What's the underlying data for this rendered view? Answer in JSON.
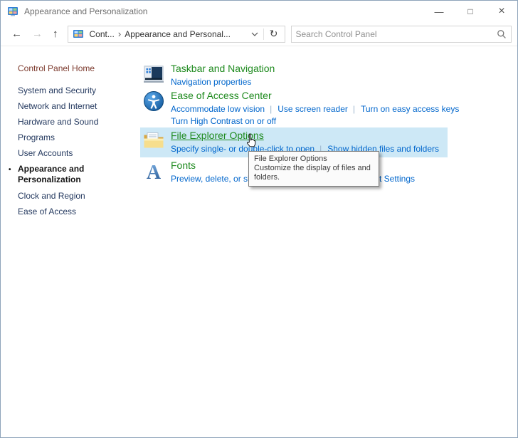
{
  "window": {
    "title": "Appearance and Personalization",
    "minimize_glyph": "—",
    "maximize_glyph": "□",
    "close_glyph": "×"
  },
  "navbar": {
    "back_glyph": "←",
    "forward_glyph": "→",
    "up_glyph": "↑",
    "refresh_glyph": "↻",
    "separator_glyph": "›",
    "breadcrumb": [
      {
        "label": "Cont..."
      },
      {
        "label": "Appearance and Personal..."
      }
    ],
    "search_placeholder": "Search Control Panel"
  },
  "sidebar": {
    "active_bullet": "•",
    "items": [
      {
        "label": "Control Panel Home"
      },
      {
        "label": "System and Security"
      },
      {
        "label": "Network and Internet"
      },
      {
        "label": "Hardware and Sound"
      },
      {
        "label": "Programs"
      },
      {
        "label": "User Accounts"
      },
      {
        "label": "Appearance and Personalization"
      },
      {
        "label": "Clock and Region"
      },
      {
        "label": "Ease of Access"
      }
    ]
  },
  "main": {
    "sections": [
      {
        "icon": "taskbar-navigation-icon",
        "title": "Taskbar and Navigation",
        "rows": [
          [
            "Navigation properties"
          ]
        ]
      },
      {
        "icon": "ease-of-access-icon",
        "title": "Ease of Access Center",
        "rows": [
          [
            "Accommodate low vision",
            "Use screen reader",
            "Turn on easy access keys"
          ],
          [
            "Turn High Contrast on or off"
          ]
        ]
      },
      {
        "icon": "file-explorer-options-icon",
        "title": "File Explorer Options",
        "hovered": true,
        "rows": [
          [
            "Specify single- or double-click to open",
            "Show hidden files and folders"
          ]
        ]
      },
      {
        "icon": "fonts-icon",
        "title": "Fonts",
        "rows": [
          [
            "Preview, delete, or show and hide fonts",
            "Change Font Settings"
          ]
        ]
      }
    ]
  },
  "tooltip": {
    "title": "File Explorer Options",
    "body": "Customize the display of files and folders."
  },
  "colors": {
    "category_green": "#1e8a1e",
    "task_link_blue": "#0066cc",
    "hover_highlight": "#cde8f6",
    "sidebar_link": "#24395f",
    "sidebar_home": "#7c3a2d"
  }
}
